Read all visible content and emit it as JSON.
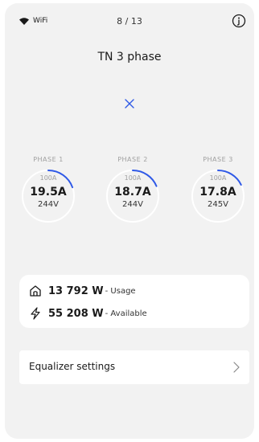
{
  "status_bar": {
    "wifi_label": "WiFi",
    "page_counter": "8 / 13"
  },
  "title": "TN 3 phase",
  "accent_color": "#2f59e6",
  "phases": [
    {
      "label": "PHASE 1",
      "max": "100A",
      "current": "19.5A",
      "voltage": "244V",
      "load_fraction": 0.195
    },
    {
      "label": "PHASE 2",
      "max": "100A",
      "current": "18.7A",
      "voltage": "244V",
      "load_fraction": 0.187
    },
    {
      "label": "PHASE 3",
      "max": "100A",
      "current": "17.8A",
      "voltage": "245V",
      "load_fraction": 0.178
    }
  ],
  "power": {
    "usage_value": "13 792 W",
    "usage_label": "- Usage",
    "available_value": "55 208 W",
    "available_label": "- Available"
  },
  "settings": {
    "equalizer_label": "Equalizer settings"
  },
  "icons": {
    "wifi": "wifi-icon",
    "info": "info-icon",
    "close": "close-icon",
    "home": "home-icon",
    "bolt": "lightning-icon",
    "chevron": "chevron-right-icon"
  }
}
